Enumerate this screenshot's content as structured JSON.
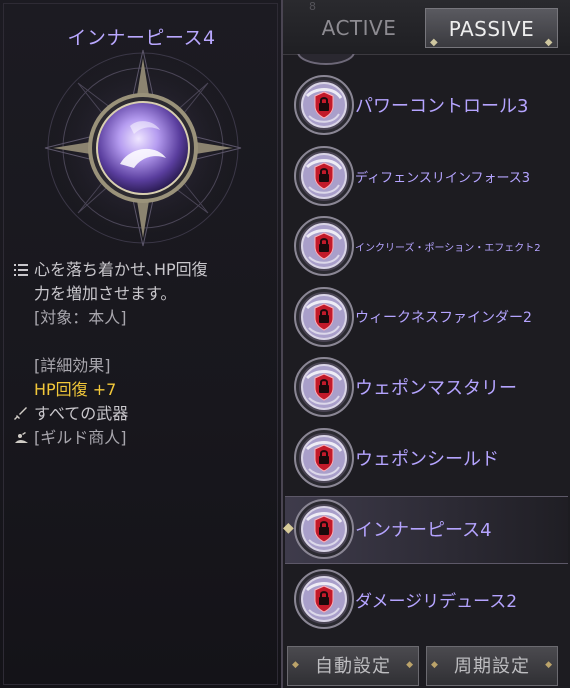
{
  "detail": {
    "title": "インナーピース4",
    "description_line1": "心を落ち着かせ､HP回復",
    "description_line2": "力を増加させます。",
    "target": "[対象：本人]",
    "detail_header": "[詳細効果]",
    "effect": "HP回復 +7",
    "weapon": "すべての武器",
    "source": "[ギルド商人]"
  },
  "tabs": {
    "active_label": "ACTIVE",
    "passive_label": "PASSIVE"
  },
  "list": {
    "top_number": "8",
    "items": [
      {
        "label": "パワーコントロール3",
        "size": 18
      },
      {
        "label": "ディフェンスリインフォース3",
        "size": 13
      },
      {
        "label": "インクリーズ・ポーション・エフェクト2",
        "size": 10
      },
      {
        "label": "ウィークネスファインダー2",
        "size": 14
      },
      {
        "label": "ウェポンマスタリー",
        "size": 18
      },
      {
        "label": "ウェポンシールド",
        "size": 18
      },
      {
        "label": "インナーピース4",
        "size": 18
      },
      {
        "label": "ダメージリデュース2",
        "size": 17
      }
    ],
    "selected_index": 6
  },
  "buttons": {
    "auto_label": "自動設定",
    "cycle_label": "周期設定"
  },
  "colors": {
    "title": "#b9a7ff",
    "item_label": "#b5a4ff",
    "effect": "#f2c83a",
    "lock": "#c21a2a"
  }
}
